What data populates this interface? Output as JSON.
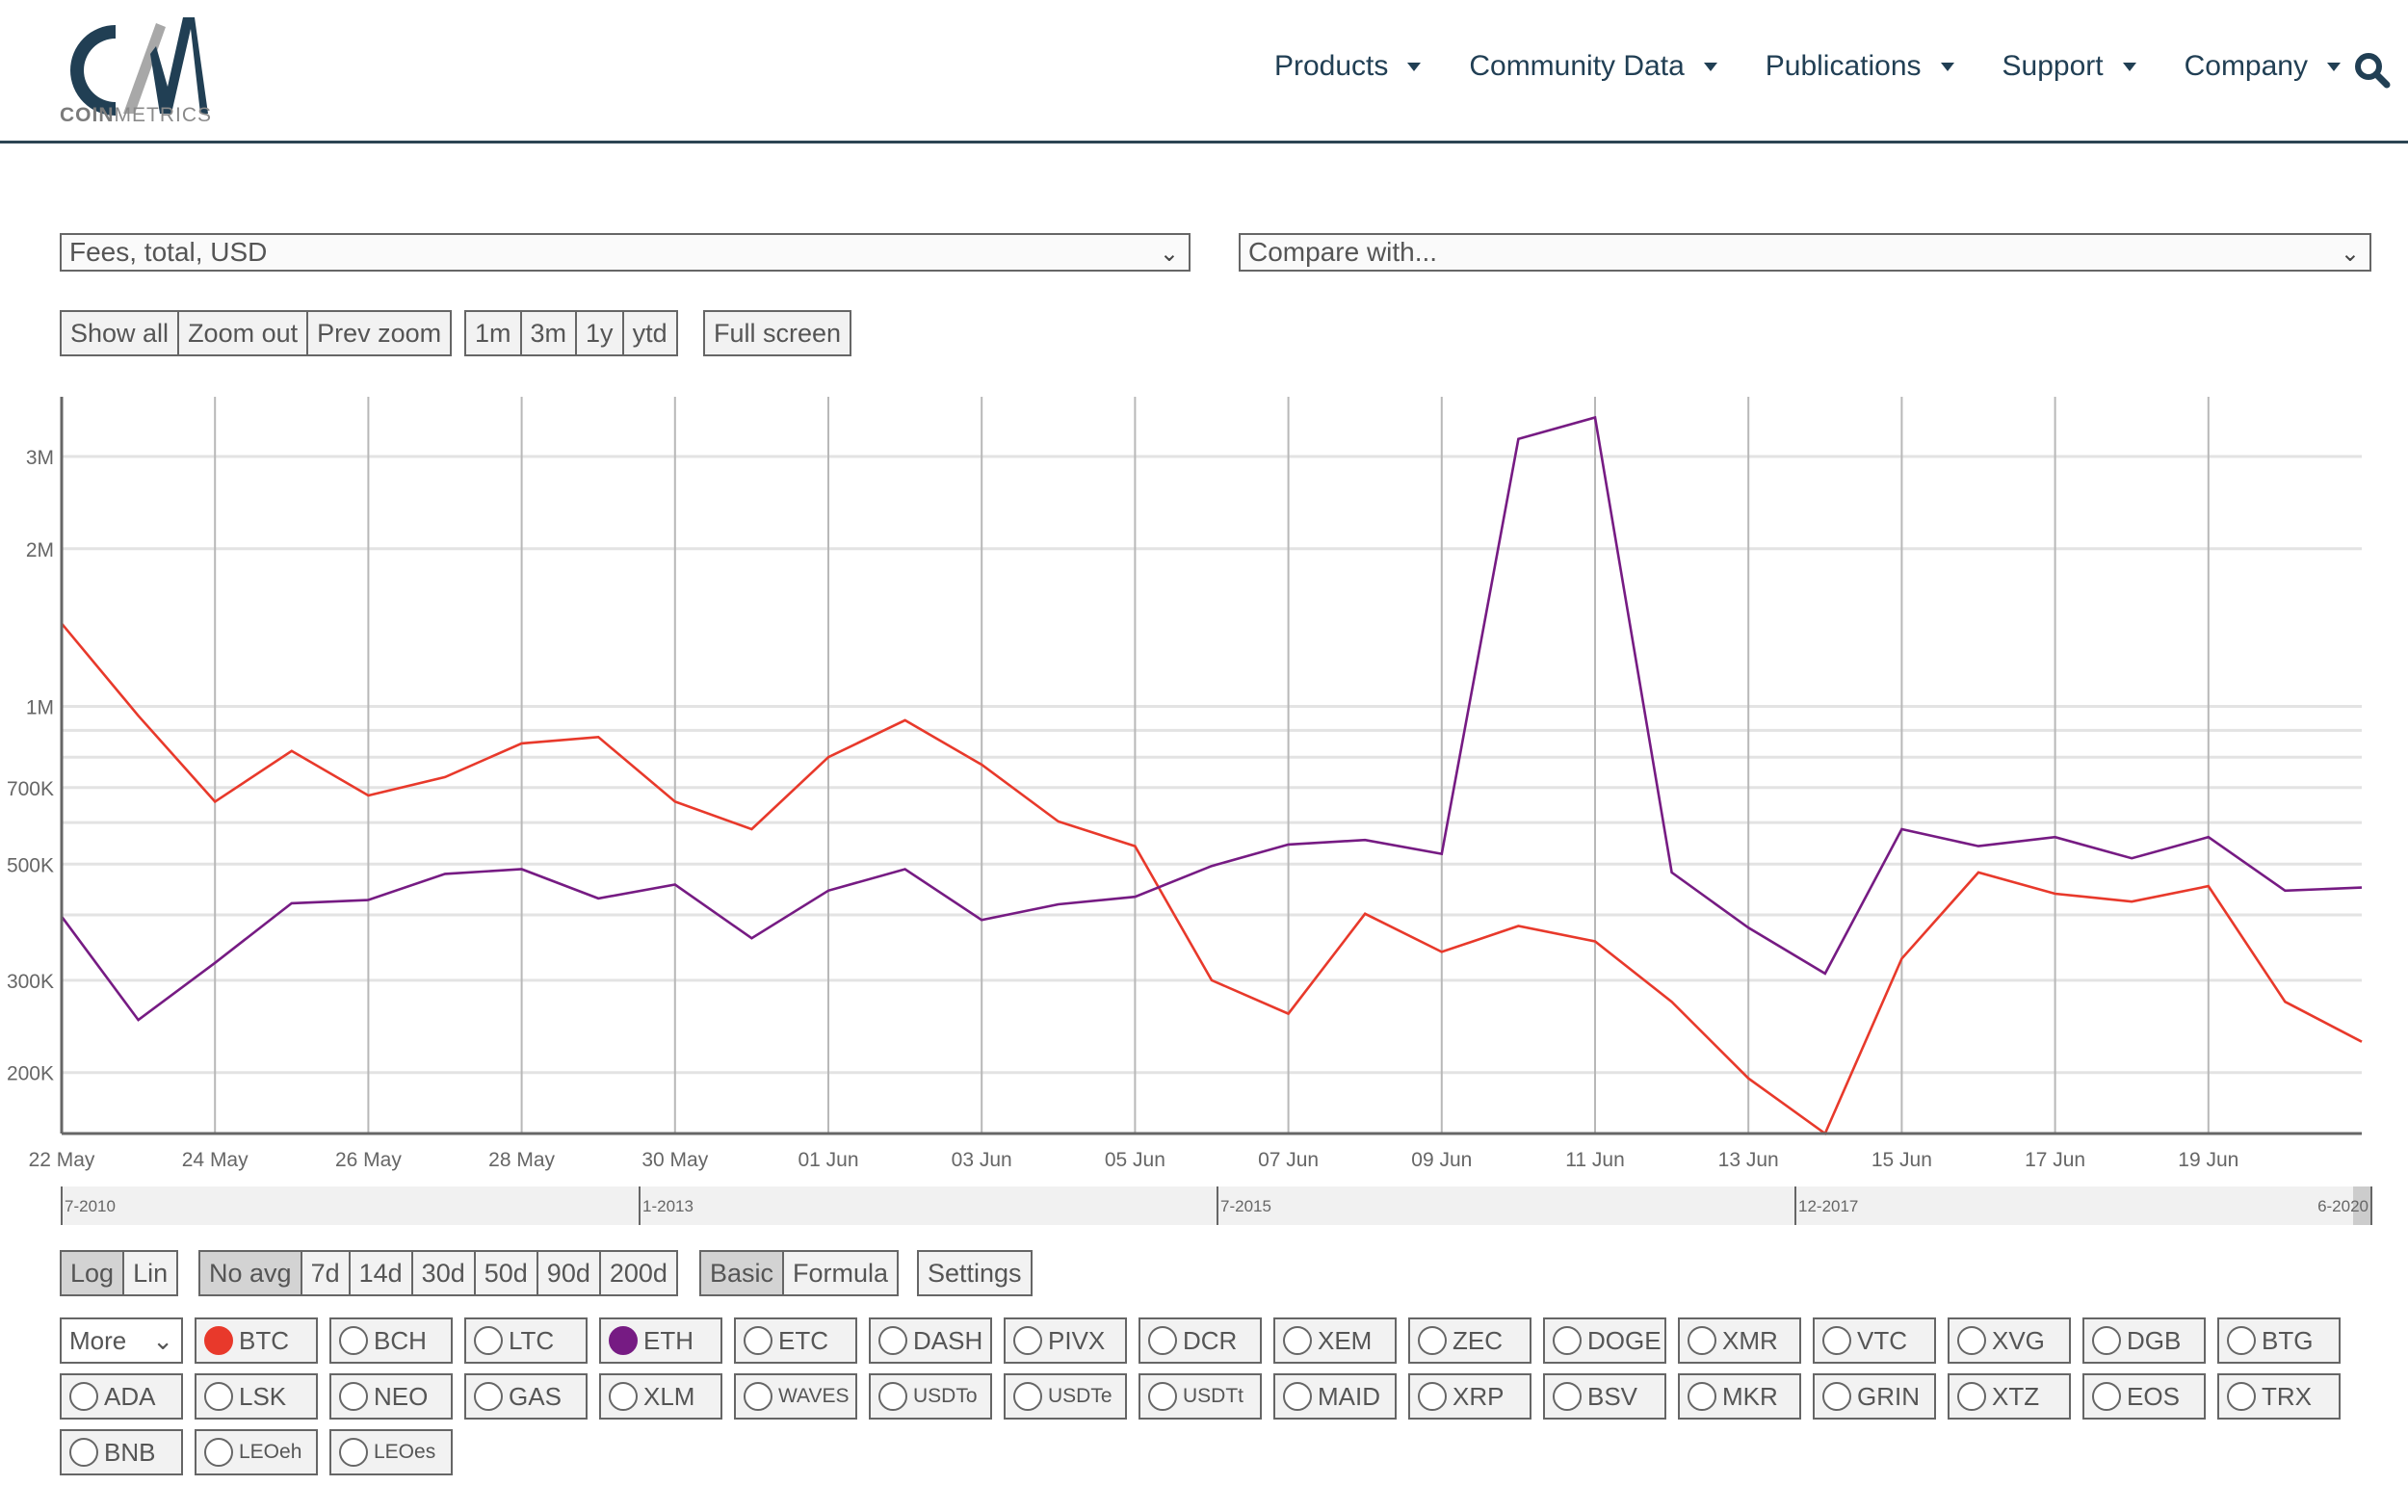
{
  "brand": {
    "logo_letters": "CM",
    "name_bold": "COIN",
    "name_light": "METRICS",
    "colors": {
      "navy": "#213f54",
      "gray": "#a8a8a8"
    }
  },
  "nav": {
    "items": [
      "Products",
      "Community Data",
      "Publications",
      "Support",
      "Company"
    ],
    "search_icon": "search-icon"
  },
  "controls": {
    "metric_select": "Fees, total, USD",
    "compare_select": "Compare with...",
    "zoom_buttons": [
      "Show all",
      "Zoom out",
      "Prev zoom"
    ],
    "range_buttons": [
      "1m",
      "3m",
      "1y",
      "ytd"
    ],
    "fullscreen": "Full screen",
    "scale_buttons": [
      "Log",
      "Lin"
    ],
    "scale_active": "Log",
    "avg_buttons": [
      "No avg",
      "7d",
      "14d",
      "30d",
      "50d",
      "90d",
      "200d"
    ],
    "avg_active": "No avg",
    "mode_buttons": [
      "Basic",
      "Formula"
    ],
    "mode_active": "Basic",
    "settings": "Settings"
  },
  "navigator": {
    "ticks": [
      "7-2010",
      "1-2013",
      "7-2015",
      "12-2017"
    ],
    "end_label": "6-2020"
  },
  "assets": {
    "more_label": "More",
    "rows": [
      [
        "BTC",
        "BCH",
        "LTC",
        "ETH",
        "ETC",
        "DASH",
        "PIVX",
        "DCR",
        "XEM",
        "ZEC",
        "DOGE",
        "XMR",
        "VTC",
        "XVG",
        "DGB",
        "BTG"
      ],
      [
        "ADA",
        "LSK",
        "NEO",
        "GAS",
        "XLM",
        "WAVES",
        "USDTo",
        "USDTe",
        "USDTt",
        "MAID",
        "XRP",
        "BSV",
        "MKR",
        "GRIN",
        "XTZ",
        "EOS",
        "TRX"
      ],
      [
        "BNB",
        "LEOeh",
        "LEOes"
      ]
    ],
    "selected": {
      "BTC": "#e8392b",
      "ETH": "#761b83"
    }
  },
  "chart_data": {
    "type": "line",
    "title": "Fees, total, USD",
    "xlabel": "",
    "ylabel": "",
    "yscale": "log",
    "ylim": [
      153000,
      3900000
    ],
    "y_ticks": [
      200000,
      300000,
      500000,
      700000,
      1000000,
      2000000,
      3000000
    ],
    "y_tick_labels": [
      "200K",
      "300K",
      "500K",
      "700K",
      "1M",
      "2M",
      "3M"
    ],
    "y_minor_grid": [
      400000,
      600000,
      800000,
      900000
    ],
    "x": [
      "22 May",
      "23 May",
      "24 May",
      "25 May",
      "26 May",
      "27 May",
      "28 May",
      "29 May",
      "30 May",
      "31 May",
      "01 Jun",
      "02 Jun",
      "03 Jun",
      "04 Jun",
      "05 Jun",
      "06 Jun",
      "07 Jun",
      "08 Jun",
      "09 Jun",
      "10 Jun",
      "11 Jun",
      "12 Jun",
      "13 Jun",
      "14 Jun",
      "15 Jun",
      "16 Jun",
      "17 Jun",
      "18 Jun",
      "19 Jun",
      "20 Jun",
      "21 Jun"
    ],
    "x_tick_labels": [
      "22 May",
      "24 May",
      "26 May",
      "28 May",
      "30 May",
      "01 Jun",
      "03 Jun",
      "05 Jun",
      "07 Jun",
      "09 Jun",
      "11 Jun",
      "13 Jun",
      "15 Jun",
      "17 Jun",
      "19 Jun"
    ],
    "grid": true,
    "legend": "none",
    "series": [
      {
        "name": "BTC",
        "color": "#e8392b",
        "values": [
          1440000,
          960000,
          658000,
          822000,
          676000,
          733000,
          850000,
          874000,
          658000,
          583000,
          800000,
          941000,
          774000,
          603000,
          541000,
          300000,
          259000,
          402000,
          340000,
          381000,
          356000,
          273000,
          195000,
          153000,
          330000,
          482000,
          439000,
          424000,
          454000,
          273000,
          229000
        ]
      },
      {
        "name": "ETH",
        "color": "#761b83",
        "values": [
          397000,
          252000,
          324000,
          421000,
          427000,
          479000,
          489000,
          430000,
          457000,
          361000,
          445000,
          489000,
          391000,
          419000,
          433000,
          496000,
          545000,
          556000,
          523000,
          3240000,
          3560000,
          482000,
          378000,
          309000,
          583000,
          541000,
          563000,
          513000,
          563000,
          445000,
          451000
        ]
      }
    ]
  }
}
